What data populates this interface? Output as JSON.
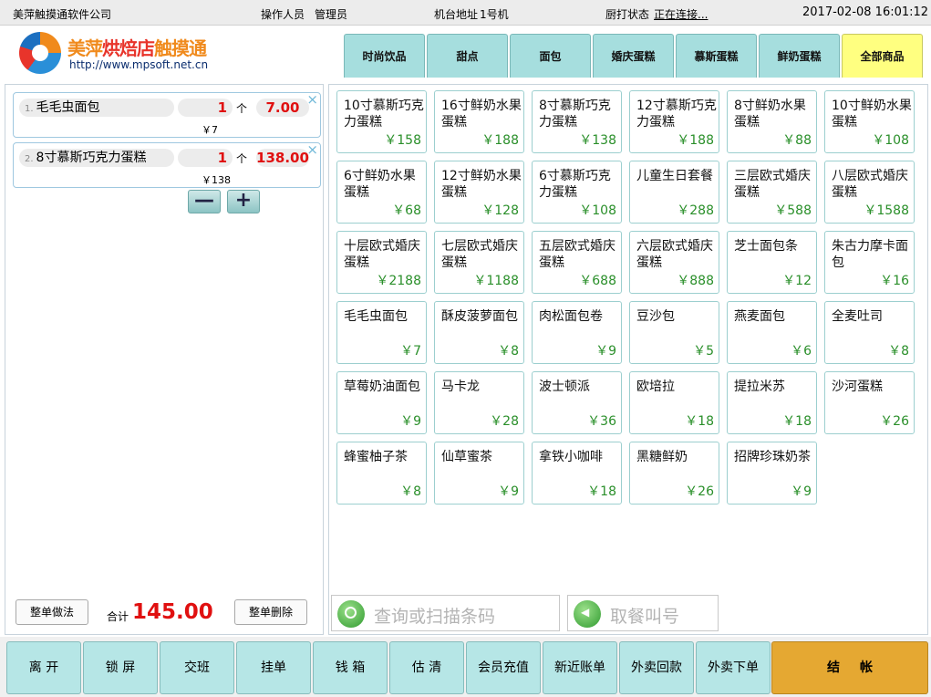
{
  "header": {
    "company": "美萍触摸通软件公司",
    "operator_label": "操作人员",
    "operator": "管理员",
    "terminal_label": "机台地址",
    "terminal": "1号机",
    "kitchen_print_label": "厨打状态",
    "kitchen_print_status": "正在连接...",
    "datetime": "2017-02-08 16:01:12"
  },
  "logo": {
    "brand_part1": "美萍",
    "brand_part2": "烘焙店",
    "brand_part3": "触摸通",
    "url": "http://www.mpsoft.net.cn"
  },
  "tabs": [
    {
      "label": "时尚饮品"
    },
    {
      "label": "甜点"
    },
    {
      "label": "面包"
    },
    {
      "label": "婚庆蛋糕"
    },
    {
      "label": "慕斯蛋糕"
    },
    {
      "label": "鲜奶蛋糕"
    },
    {
      "label": "全部商品",
      "active": true
    }
  ],
  "order": {
    "items": [
      {
        "index": "1.",
        "name": "毛毛虫面包",
        "qty": "1",
        "unit": "个",
        "amount": "7.00",
        "unit_price": "￥7"
      },
      {
        "index": "2.",
        "name": "8寸慕斯巧克力蛋糕",
        "qty": "1",
        "unit": "个",
        "amount": "138.00",
        "unit_price": "￥138"
      }
    ],
    "close_icon": "×",
    "minus_label": "—",
    "plus_label": "+",
    "whole_method_label": "整单做法",
    "total_label": "合计",
    "total_value": "145.00",
    "whole_delete_label": "整单删除"
  },
  "products": [
    {
      "name": "10寸慕斯巧克力蛋糕",
      "price": "￥158"
    },
    {
      "name": "16寸鲜奶水果蛋糕",
      "price": "￥188"
    },
    {
      "name": "8寸慕斯巧克力蛋糕",
      "price": "￥138"
    },
    {
      "name": "12寸慕斯巧克力蛋糕",
      "price": "￥188"
    },
    {
      "name": "8寸鲜奶水果蛋糕",
      "price": "￥88"
    },
    {
      "name": "10寸鲜奶水果蛋糕",
      "price": "￥108"
    },
    {
      "name": "6寸鲜奶水果蛋糕",
      "price": "￥68"
    },
    {
      "name": "12寸鲜奶水果蛋糕",
      "price": "￥128"
    },
    {
      "name": "6寸慕斯巧克力蛋糕",
      "price": "￥108"
    },
    {
      "name": "儿童生日套餐",
      "price": "￥288"
    },
    {
      "name": "三层欧式婚庆蛋糕",
      "price": "￥588"
    },
    {
      "name": "八层欧式婚庆蛋糕",
      "price": "￥1588"
    },
    {
      "name": "十层欧式婚庆蛋糕",
      "price": "￥2188"
    },
    {
      "name": "七层欧式婚庆蛋糕",
      "price": "￥1188"
    },
    {
      "name": "五层欧式婚庆蛋糕",
      "price": "￥688"
    },
    {
      "name": "六层欧式婚庆蛋糕",
      "price": "￥888"
    },
    {
      "name": "芝士面包条",
      "price": "￥12"
    },
    {
      "name": "朱古力摩卡面包",
      "price": "￥16"
    },
    {
      "name": "毛毛虫面包",
      "price": "￥7"
    },
    {
      "name": "酥皮菠萝面包",
      "price": "￥8"
    },
    {
      "name": "肉松面包卷",
      "price": "￥9"
    },
    {
      "name": "豆沙包",
      "price": "￥5"
    },
    {
      "name": "燕麦面包",
      "price": "￥6"
    },
    {
      "name": "全麦吐司",
      "price": "￥8"
    },
    {
      "name": "草莓奶油面包",
      "price": "￥9"
    },
    {
      "name": "马卡龙",
      "price": "￥28"
    },
    {
      "name": "波士顿派",
      "price": "￥36"
    },
    {
      "name": "欧培拉",
      "price": "￥18"
    },
    {
      "name": "提拉米苏",
      "price": "￥18"
    },
    {
      "name": "沙河蛋糕",
      "price": "￥26"
    },
    {
      "name": "蜂蜜柚子茶",
      "price": "￥8"
    },
    {
      "name": "仙草蜜茶",
      "price": "￥9"
    },
    {
      "name": "拿铁小咖啡",
      "price": "￥18"
    },
    {
      "name": "黑糖鲜奶",
      "price": "￥26"
    },
    {
      "name": "招牌珍珠奶茶",
      "price": "￥9"
    }
  ],
  "search": {
    "barcode_placeholder": "查询或扫描条码",
    "call_number_placeholder": "取餐叫号"
  },
  "actions": [
    {
      "label": "离 开"
    },
    {
      "label": "锁 屏"
    },
    {
      "label": "交班"
    },
    {
      "label": "挂单"
    },
    {
      "label": "钱 箱"
    },
    {
      "label": "估 清"
    },
    {
      "label": "会员充值"
    },
    {
      "label": "新近账单"
    },
    {
      "label": "外卖回款"
    },
    {
      "label": "外卖下单"
    }
  ],
  "checkout_label": "结帐",
  "colors": {
    "tab": "#a6dede",
    "tab_active": "#ffff80",
    "price_green": "#2a8f2a",
    "amount_red": "#e01010",
    "checkout": "#e5a832"
  }
}
